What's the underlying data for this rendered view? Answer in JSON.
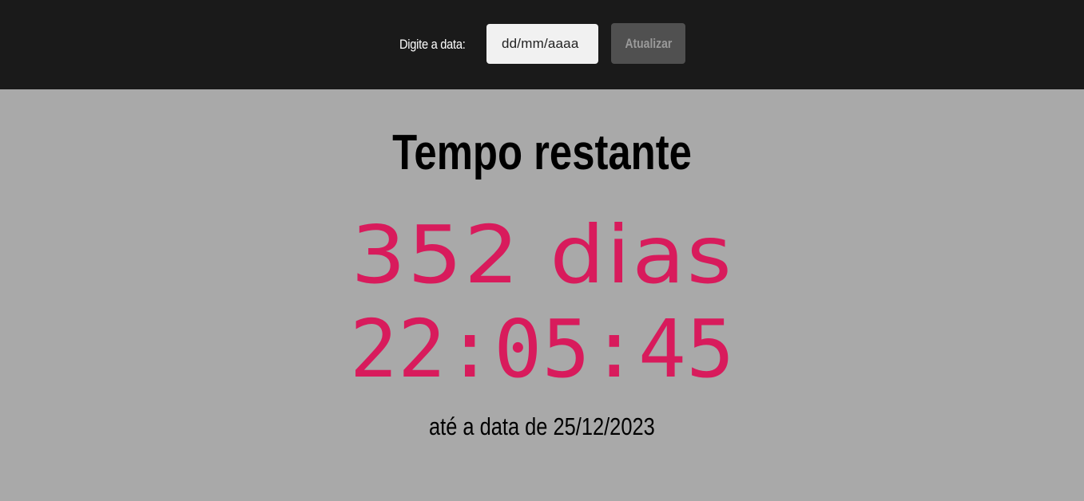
{
  "header": {
    "date_label": "Digite a data:",
    "date_input_placeholder": "dd/mm/aaaa",
    "date_input_value": "",
    "update_button_label": "Atualizar"
  },
  "countdown": {
    "title": "Tempo restante",
    "days_text": "352 dias",
    "time_text": "22:05:45",
    "until_text": "até a data de 25/12/2023"
  },
  "colors": {
    "header_background": "#1a1a1a",
    "page_background": "#a9a9a9",
    "accent": "#d81b5c",
    "button_background": "#505050"
  }
}
